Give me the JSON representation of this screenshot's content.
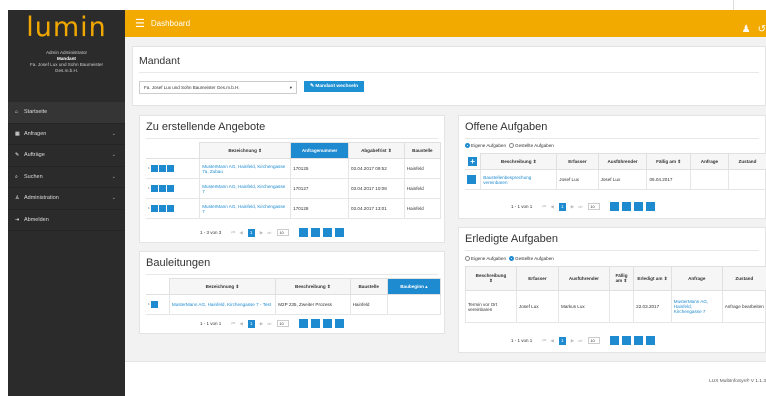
{
  "app": {
    "logo": "lumin"
  },
  "user": {
    "line1": "Admin Administrator",
    "line2": "Mandant",
    "line3": "Fa. Josef Lux und Sohn Baumeister",
    "line4": "Ges.m.b.H."
  },
  "sidebar": {
    "items": [
      {
        "label": "Startseite",
        "icon": "home-icon"
      },
      {
        "label": "Anfragen",
        "icon": "calendar-icon"
      },
      {
        "label": "Aufträge",
        "icon": "wrench-icon"
      },
      {
        "label": "Suchen",
        "icon": "search-icon"
      },
      {
        "label": "Administration",
        "icon": "user-icon"
      },
      {
        "label": "Abmelden",
        "icon": "logout-icon"
      }
    ]
  },
  "header": {
    "title": "Dashboard"
  },
  "mandant": {
    "title": "Mandant",
    "selected": "Fa. Josef Lux und Sohn Baumeister Ges.m.b.H.",
    "button": "Mandant wechseln"
  },
  "angebote": {
    "title": "Zu erstellende Angebote",
    "columns": [
      "Bezeichnung",
      "Anfragenummer",
      "Abgabefrist",
      "Baustelle"
    ],
    "rows": [
      {
        "bez": "MusterMann AG, Hainfeld, Kirchengasse 7a, Zubau",
        "nr": "170125",
        "frist": "03.04.2017 09:52",
        "baustelle": "Hainfeld"
      },
      {
        "bez": "MusterMann AG, Hainfeld, Kirchengasse 7",
        "nr": "170127",
        "frist": "03.04.2017 10:08",
        "baustelle": "Hainfeld"
      },
      {
        "bez": "MusterMann AG, Hainfeld, Kirchengasse 7",
        "nr": "170128",
        "frist": "03.04.2017 13:01",
        "baustelle": "Hainfeld"
      }
    ],
    "pager": {
      "info": "1 - 3 von 3",
      "page": "1",
      "size": "10"
    }
  },
  "bauleitungen": {
    "title": "Bauleitungen",
    "columns": [
      "Bezeichnung",
      "Beschreibung",
      "Baustelle",
      "Baubeginn"
    ],
    "rows": [
      {
        "bez": "MusterMann AG, Hainfeld, Kirchengasse 7 - Test",
        "beschr": "M2P 235, Zweiter Prozess",
        "baustelle": "Hainfeld",
        "beginn": ""
      }
    ],
    "pager": {
      "info": "1 - 1 von 1",
      "page": "1",
      "size": "10"
    }
  },
  "offene": {
    "title": "Offene Aufgaben",
    "radio1": "Eigene Aufgaben",
    "radio2": "Gestellte Aufgaben",
    "columns": [
      "Beschreibung",
      "Erfasser",
      "Ausführender",
      "Fällig am",
      "Anfrage",
      "Zustand"
    ],
    "rows": [
      {
        "beschr": "Baustellenbesprechung vereinbaren",
        "erfasser": "Josef Lux",
        "ausf": "Josef Lux",
        "faellig": "06.04.2017",
        "anfrage": "",
        "zustand": ""
      }
    ],
    "pager": {
      "info": "1 - 1 von 1",
      "page": "1",
      "size": "10"
    }
  },
  "erledigte": {
    "title": "Erledigte Aufgaben",
    "radio1": "Eigene Aufgaben",
    "radio2": "Gestellte Aufgaben",
    "columns": [
      "Beschreibung",
      "Erfasser",
      "Ausführender",
      "Fällig am",
      "Erledigt am",
      "Anfrage",
      "Zustand"
    ],
    "rows": [
      {
        "beschr": "Termin vor Ort vereinbaren",
        "erfasser": "Josef Lux",
        "ausf": "Markus Lux",
        "faellig": "",
        "erledigt": "22.03.2017",
        "anfrage": "MusterMann AG, Hainfeld, Kirchengasse 7",
        "zustand": "Anfrage bearbeiten"
      }
    ],
    "pager": {
      "info": "1 - 1 von 1",
      "page": "1",
      "size": "10"
    }
  },
  "footer": {
    "text": "LUX MultiInfoSys® V 1.1.3"
  },
  "colors": {
    "accent": "#f2a900",
    "primary": "#1e8bd0",
    "sidebar": "#2b2b2b"
  }
}
